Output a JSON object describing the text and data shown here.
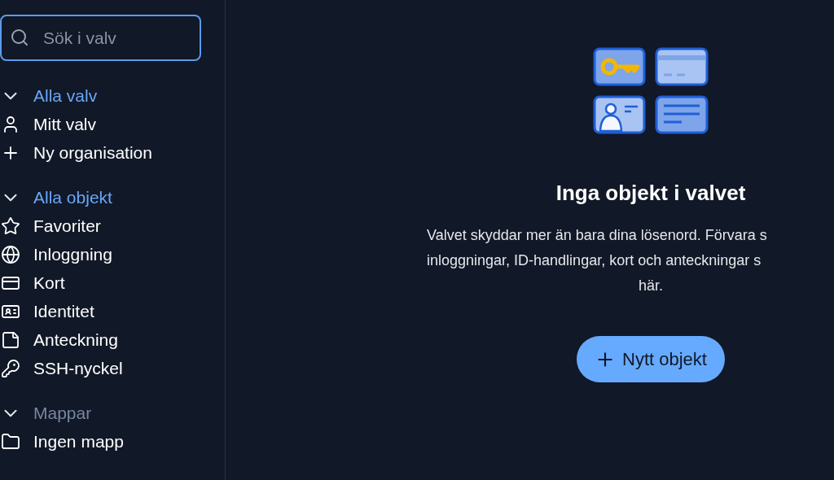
{
  "search": {
    "placeholder": "Sök i valv"
  },
  "sidebar": {
    "sections": [
      {
        "title": "Alla valv",
        "expanded": true,
        "muted": false,
        "items": [
          {
            "label": "Mitt valv",
            "kind": "person"
          },
          {
            "label": "Ny organisation",
            "kind": "plus"
          }
        ]
      },
      {
        "title": "Alla objekt",
        "expanded": true,
        "muted": false,
        "items": [
          {
            "label": "Favoriter",
            "kind": "star"
          },
          {
            "label": "Inloggning",
            "kind": "globe"
          },
          {
            "label": "Kort",
            "kind": "card"
          },
          {
            "label": "Identitet",
            "kind": "id"
          },
          {
            "label": "Anteckning",
            "kind": "note"
          },
          {
            "label": "SSH-nyckel",
            "kind": "key"
          }
        ]
      },
      {
        "title": "Mappar",
        "expanded": true,
        "muted": true,
        "items": [
          {
            "label": "Ingen mapp",
            "kind": "folder"
          }
        ]
      }
    ]
  },
  "main": {
    "heading": "Inga objekt i valvet",
    "description_lines": [
      "Valvet skyddar mer än bara dina lösenord. Förvara s",
      "inloggningar, ID-handlingar, kort och anteckningar s",
      "här."
    ],
    "button": {
      "label": "Nytt objekt"
    }
  }
}
